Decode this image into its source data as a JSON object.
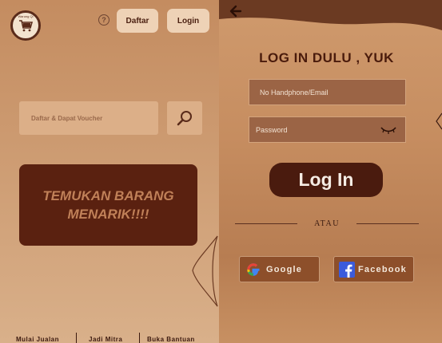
{
  "left": {
    "logo_text": "Warung Qi",
    "help_icon": "help-circle-icon",
    "buttons": {
      "daftar": "Daftar",
      "login": "Login"
    },
    "search": {
      "placeholder": "Daftar & Dapat Voucher",
      "icon": "search-icon"
    },
    "banner": {
      "line1": "TEMUKAN BARANG",
      "line2": "MENARIK!!!!"
    },
    "footer": [
      "Mulai Jualan",
      "Jadi Mitra",
      "Buka Bantuan"
    ]
  },
  "right": {
    "title": "LOG IN DULU , YUK",
    "email_placeholder": "No Handphone/Email",
    "password_placeholder": "Password",
    "login_label": "Log In",
    "divider_text": "ATAU",
    "social": {
      "google": "Google",
      "facebook": "Facebook"
    }
  },
  "colors": {
    "dark_brown": "#4a1b0e",
    "banner_bg": "#5a2110",
    "button_light": "#eed2b6",
    "field_bg": "#9b6445"
  }
}
